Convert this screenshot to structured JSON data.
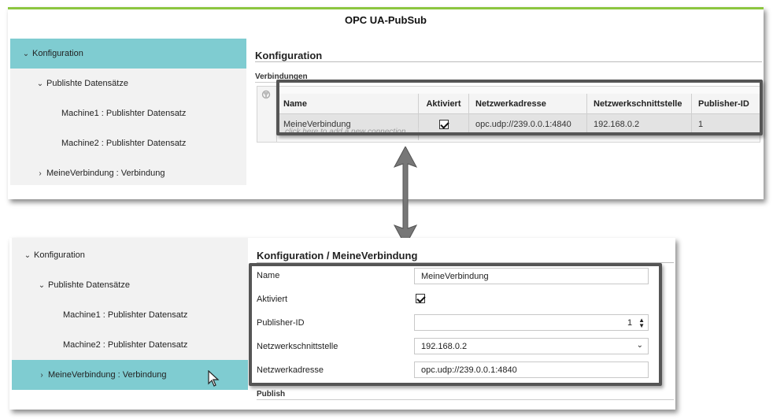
{
  "app": {
    "title": "OPC UA-PubSub"
  },
  "top": {
    "sidebar": {
      "items": [
        {
          "label": "Konfiguration",
          "chevron": "down",
          "level": 0,
          "active": true
        },
        {
          "label": "Publishte Datensätze",
          "chevron": "down",
          "level": 1,
          "active": false
        },
        {
          "label": "Machine1 : Publishter Datensatz",
          "chevron": "",
          "level": 2,
          "active": false
        },
        {
          "label": "Machine2 : Publishter Datensatz",
          "chevron": "",
          "level": 2,
          "active": false
        },
        {
          "label": "MeineVerbindung : Verbindung",
          "chevron": "right",
          "level": 1,
          "active": false
        }
      ]
    },
    "content_title": "Konfiguration",
    "section_label": "Verbindungen",
    "grid": {
      "columns": [
        "Name",
        "Aktiviert",
        "Netzwerkadresse",
        "Netzwerkschnittstelle",
        "Publisher-ID"
      ],
      "rows": [
        {
          "name": "MeineVerbindung",
          "enabled": true,
          "address": "opc.udp://239.0.0.1:4840",
          "interface": "192.168.0.2",
          "publisher_id": "1"
        }
      ],
      "new_row_hint": "click here to add a new connection"
    }
  },
  "bottom": {
    "sidebar": {
      "items": [
        {
          "label": "Konfiguration",
          "chevron": "down",
          "level": 0,
          "active": false
        },
        {
          "label": "Publishte Datensätze",
          "chevron": "down",
          "level": 1,
          "active": false
        },
        {
          "label": "Machine1 : Publishter Datensatz",
          "chevron": "",
          "level": 2,
          "active": false
        },
        {
          "label": "Machine2 : Publishter Datensatz",
          "chevron": "",
          "level": 2,
          "active": false
        },
        {
          "label": "MeineVerbindung : Verbindung",
          "chevron": "right",
          "level": 1,
          "active": true
        }
      ]
    },
    "content_title": "Konfiguration / MeineVerbindung",
    "form": {
      "name_label": "Name",
      "name_value": "MeineVerbindung",
      "enabled_label": "Aktiviert",
      "enabled": true,
      "publisher_id_label": "Publisher-ID",
      "publisher_id_value": "1",
      "interface_label": "Netzwerkschnittstelle",
      "interface_value": "192.168.0.2",
      "address_label": "Netzwerkadresse",
      "address_value": "opc.udp://239.0.0.1:4840"
    },
    "section_label": "Publish"
  },
  "colors": {
    "active": "#7fccd1",
    "top_border": "#8cc63f",
    "highlight_box": "#555555"
  }
}
